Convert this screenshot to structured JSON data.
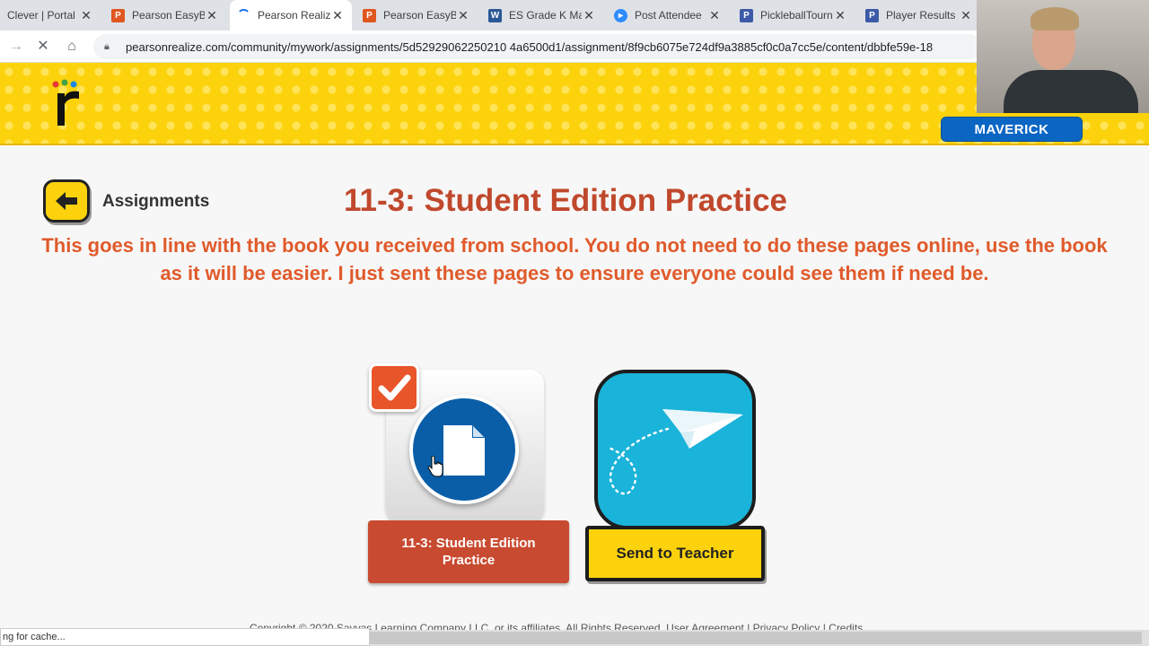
{
  "browser": {
    "tabs": [
      {
        "title": "Clever | Portal",
        "icon": "clever-icon"
      },
      {
        "title": "Pearson EasyB",
        "icon": "pearson-icon"
      },
      {
        "title": "Pearson Realiz",
        "icon": "loading-spinner-icon",
        "active": true
      },
      {
        "title": "Pearson EasyB",
        "icon": "pearson-icon"
      },
      {
        "title": "ES Grade K Ma",
        "icon": "word-icon"
      },
      {
        "title": "Post Attendee",
        "icon": "zoom-icon"
      },
      {
        "title": "PickleballTourn",
        "icon": "pickleball-icon"
      },
      {
        "title": "Player Results",
        "icon": "pickleball-icon"
      }
    ],
    "url": "pearsonrealize.com/community/mywork/assignments/5d52929062250210 4a6500d1/assignment/8f9cb6075e724df9a3885cf0c0a7cc5e/content/dbbfe59e-18",
    "status_text": "ng for cache..."
  },
  "header": {
    "user_button": "MAVERICK"
  },
  "main": {
    "back_label": "Assignments",
    "title": "11-3: Student Edition Practice",
    "note": "This goes in line with the book you received from school. You do not need to do these pages online, use the book as it will be easier. I just sent these pages to ensure everyone could see them if need be.",
    "doc_card_label": "11-3: Student Edition Practice",
    "send_card_label": "Send to Teacher"
  },
  "footer": {
    "text": "Copyright © 2020 Savvas Learning Company LLC. or its affiliates. All Rights Reserved. User Agreement | Privacy Policy | Credits"
  },
  "colors": {
    "banner_yellow": "#fcd20c",
    "title_red": "#c0482c",
    "note_orange": "#e05a2b",
    "user_blue": "#0b66c3",
    "send_cyan": "#1ab3d9"
  }
}
